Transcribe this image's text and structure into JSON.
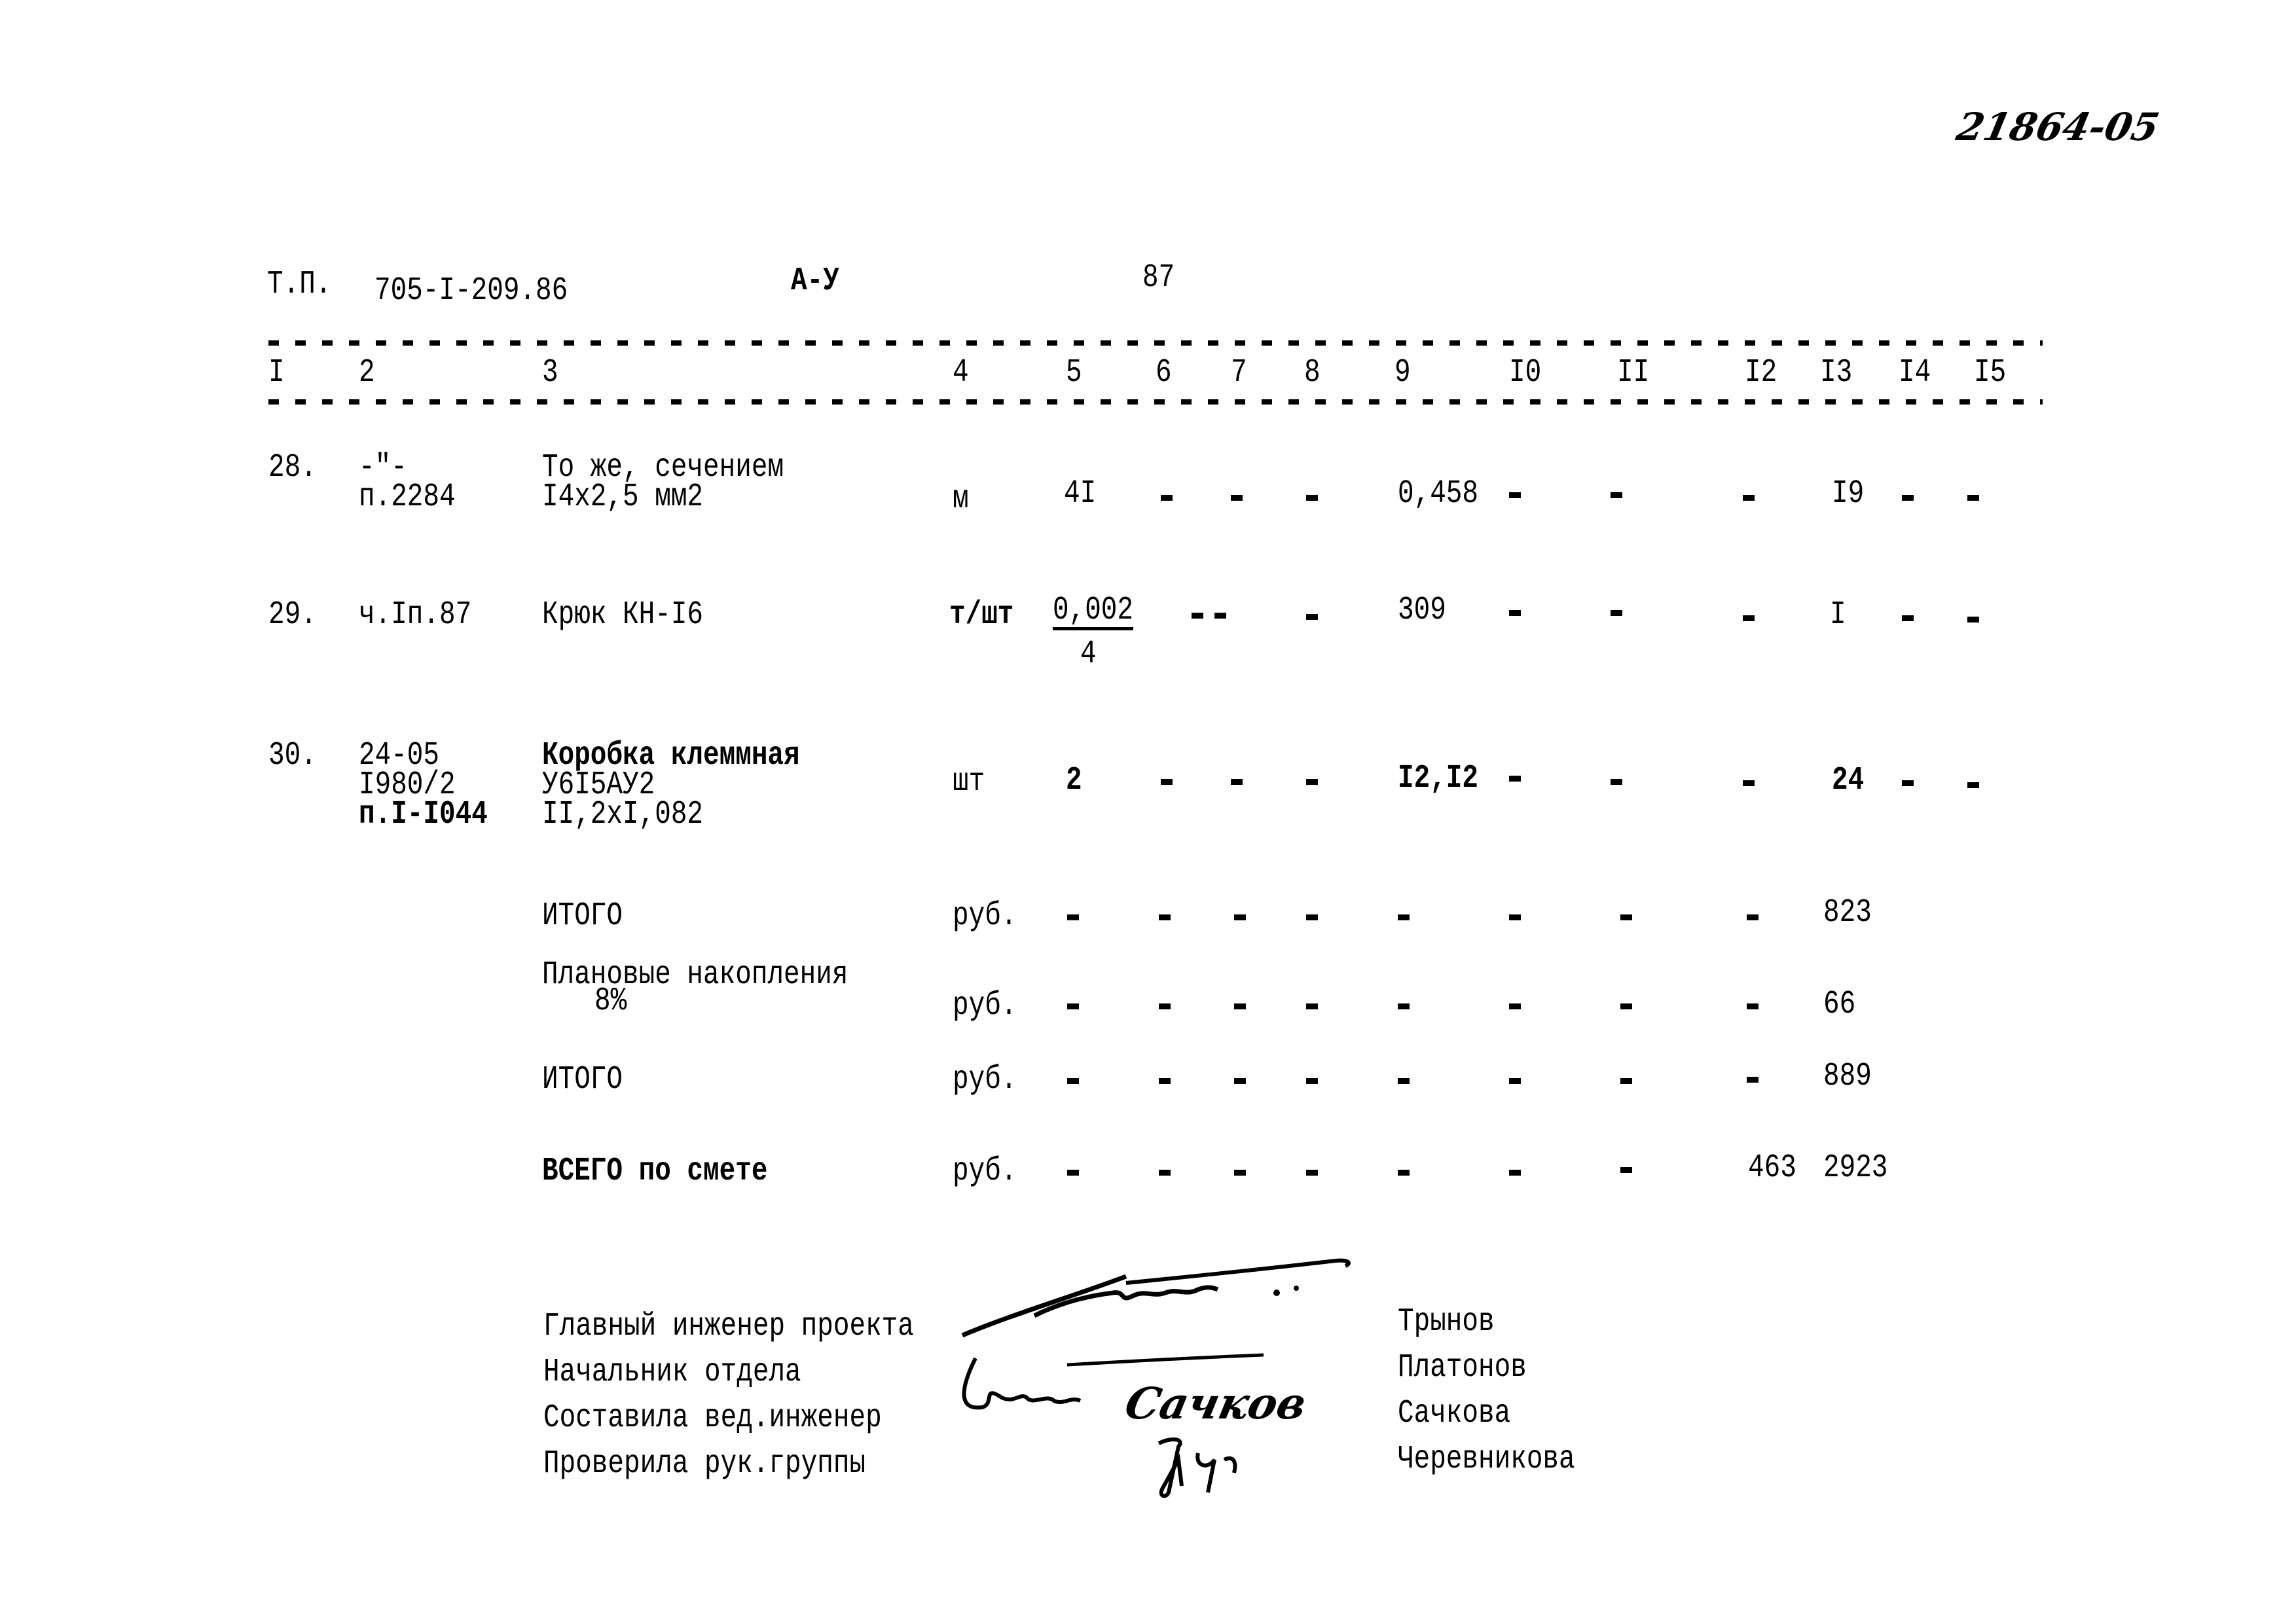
{
  "archive_number": "21864-05",
  "header": {
    "tp_label": "Т.П.",
    "project_code": "705-I-209.86",
    "section": "А-У",
    "page_number": "87"
  },
  "columns": [
    "I",
    "2",
    "3",
    "4",
    "5",
    "6",
    "7",
    "8",
    "9",
    "I0",
    "II",
    "I2",
    "I3",
    "I4",
    "I5"
  ],
  "rows": [
    {
      "no": "28.",
      "ref": [
        "-\"-",
        "п.2284"
      ],
      "name": [
        "То же, сечением",
        "I4x2,5 мм2"
      ],
      "unit": "м",
      "c5": "4I",
      "c6": "-",
      "c7": "-",
      "c8": "-",
      "c9": "0,458",
      "c10": "-",
      "c11": "-",
      "c12": "-",
      "c13": "I9",
      "c14": "-",
      "c15": "-"
    },
    {
      "no": "29.",
      "ref": [
        "ч.Iп.87"
      ],
      "name": [
        "Крюк КН-I6"
      ],
      "unit": "т/шт",
      "c5": "0,002",
      "c5_sub": "4",
      "c6": "-",
      "c7": "-",
      "c8": "-",
      "c9": "309",
      "c10": "-",
      "c11": "-",
      "c12": "-",
      "c13": "I",
      "c14": "-",
      "c15": "-"
    },
    {
      "no": "30.",
      "ref": [
        "24-05",
        "I980/2",
        "п.I-I044"
      ],
      "name": [
        "Коробка клеммная",
        "У6I5АУ2",
        "II,2xI,082"
      ],
      "unit": "шт",
      "c5": "2",
      "c6": "-",
      "c7": "-",
      "c8": "-",
      "c9": "I2,I2",
      "c10": "-",
      "c11": "-",
      "c12": "-",
      "c13": "24",
      "c14": "-",
      "c15": "-"
    }
  ],
  "totals": [
    {
      "label": [
        "ИТОГО"
      ],
      "unit": "руб.",
      "c12": "-",
      "c13": "823"
    },
    {
      "label": [
        "Плановые накопления",
        "8%"
      ],
      "unit": "руб.",
      "c12": "-",
      "c13": "66"
    },
    {
      "label": [
        "ИТОГО"
      ],
      "unit": "руб.",
      "c12": "-",
      "c13": "889"
    },
    {
      "label": [
        "ВСЕГО по смете"
      ],
      "unit": "руб.",
      "c12": "463",
      "c13": "2923"
    }
  ],
  "signatures": [
    {
      "role": "Главный инженер проекта",
      "name": "Трынов"
    },
    {
      "role": "Начальник отдела",
      "name": "Платонов"
    },
    {
      "role": "Составила вед.инженер",
      "name": "Сачкова",
      "handwritten": "Сачков"
    },
    {
      "role": "Проверила рук.группы",
      "name": "Черевникова"
    }
  ]
}
